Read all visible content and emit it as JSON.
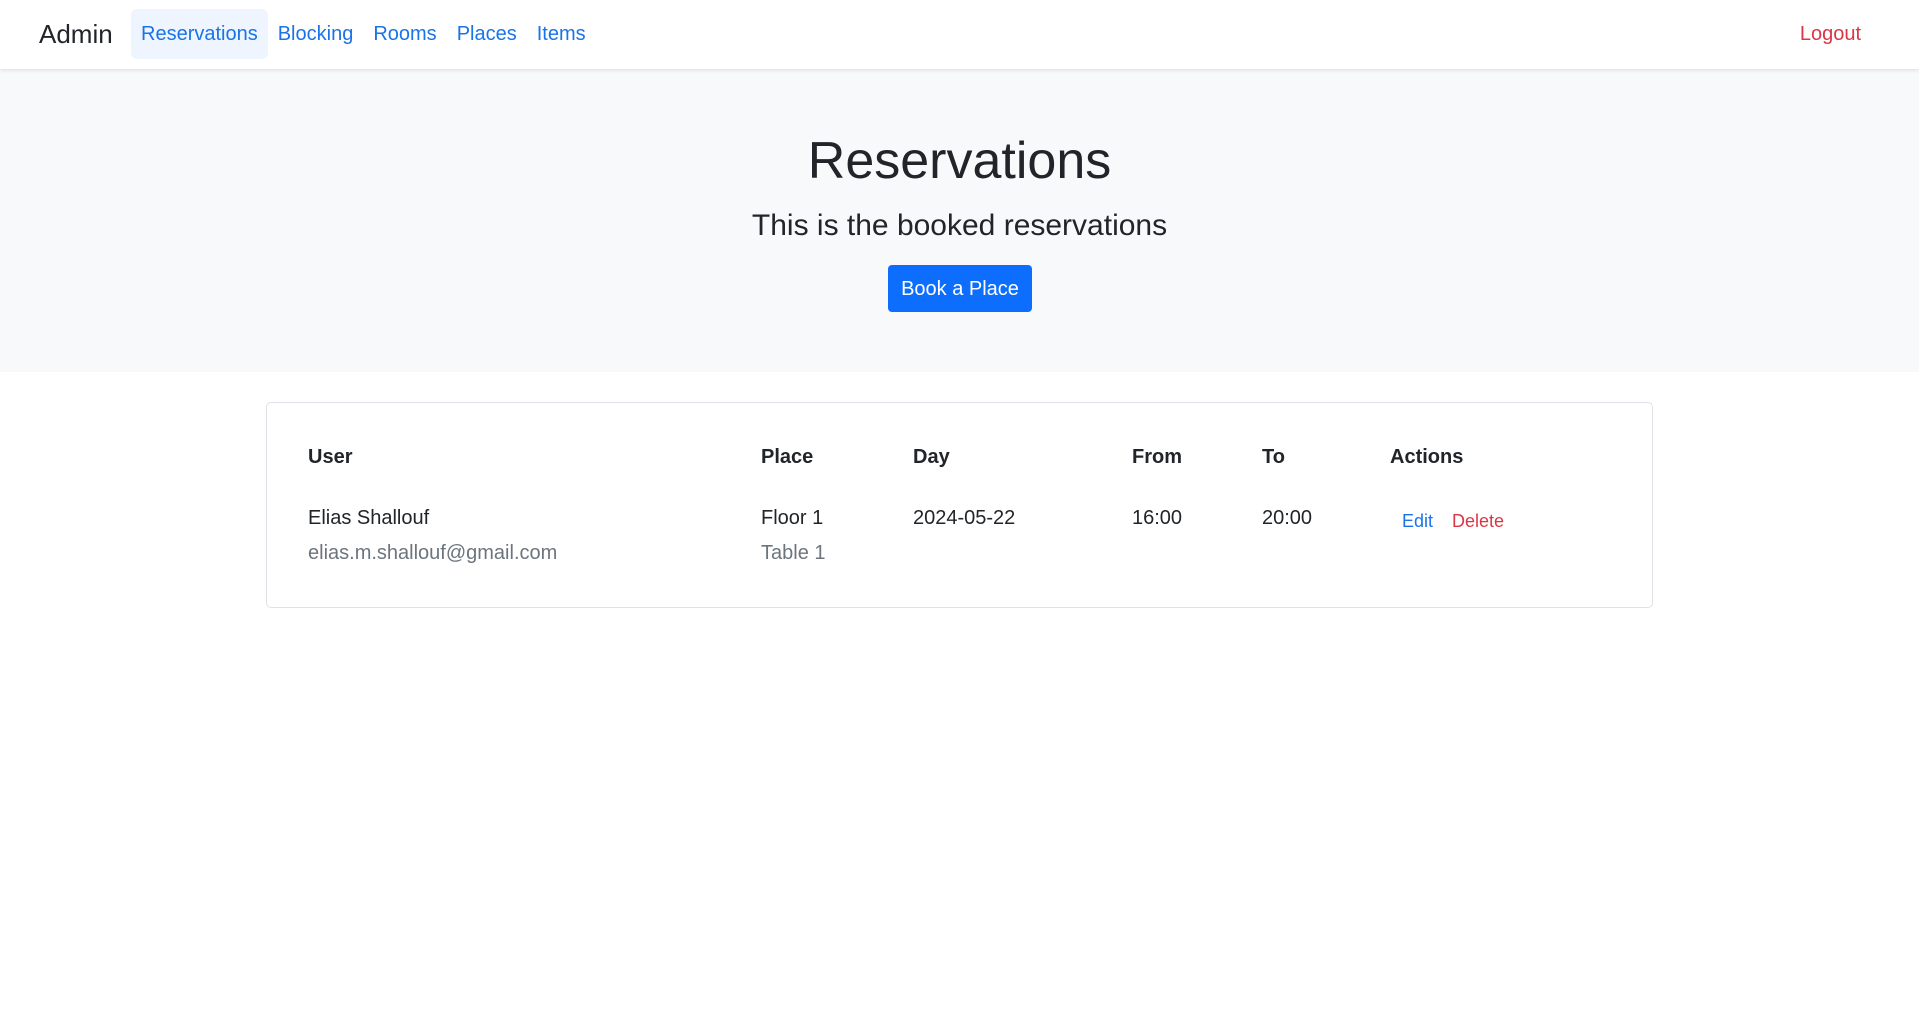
{
  "nav": {
    "brand": "Admin",
    "links": [
      {
        "label": "Reservations",
        "active": true
      },
      {
        "label": "Blocking",
        "active": false
      },
      {
        "label": "Rooms",
        "active": false
      },
      {
        "label": "Places",
        "active": false
      },
      {
        "label": "Items",
        "active": false
      }
    ],
    "logout": "Logout"
  },
  "hero": {
    "title": "Reservations",
    "subtitle": "This is the booked reservations",
    "button": "Book a Place"
  },
  "table": {
    "headers": {
      "user": "User",
      "place": "Place",
      "day": "Day",
      "from": "From",
      "to": "To",
      "actions": "Actions"
    },
    "rows": [
      {
        "user_name": "Elias Shallouf",
        "user_email": "elias.m.shallouf@gmail.com",
        "place_floor": "Floor 1",
        "place_table": "Table 1",
        "day": "2024-05-22",
        "from": "16:00",
        "to": "20:00",
        "edit": "Edit",
        "delete": "Delete"
      }
    ]
  },
  "colors": {
    "primary": "#0d6efd",
    "link": "#1a73e8",
    "danger": "#dc3545",
    "hero_bg": "#f8f9fa"
  }
}
